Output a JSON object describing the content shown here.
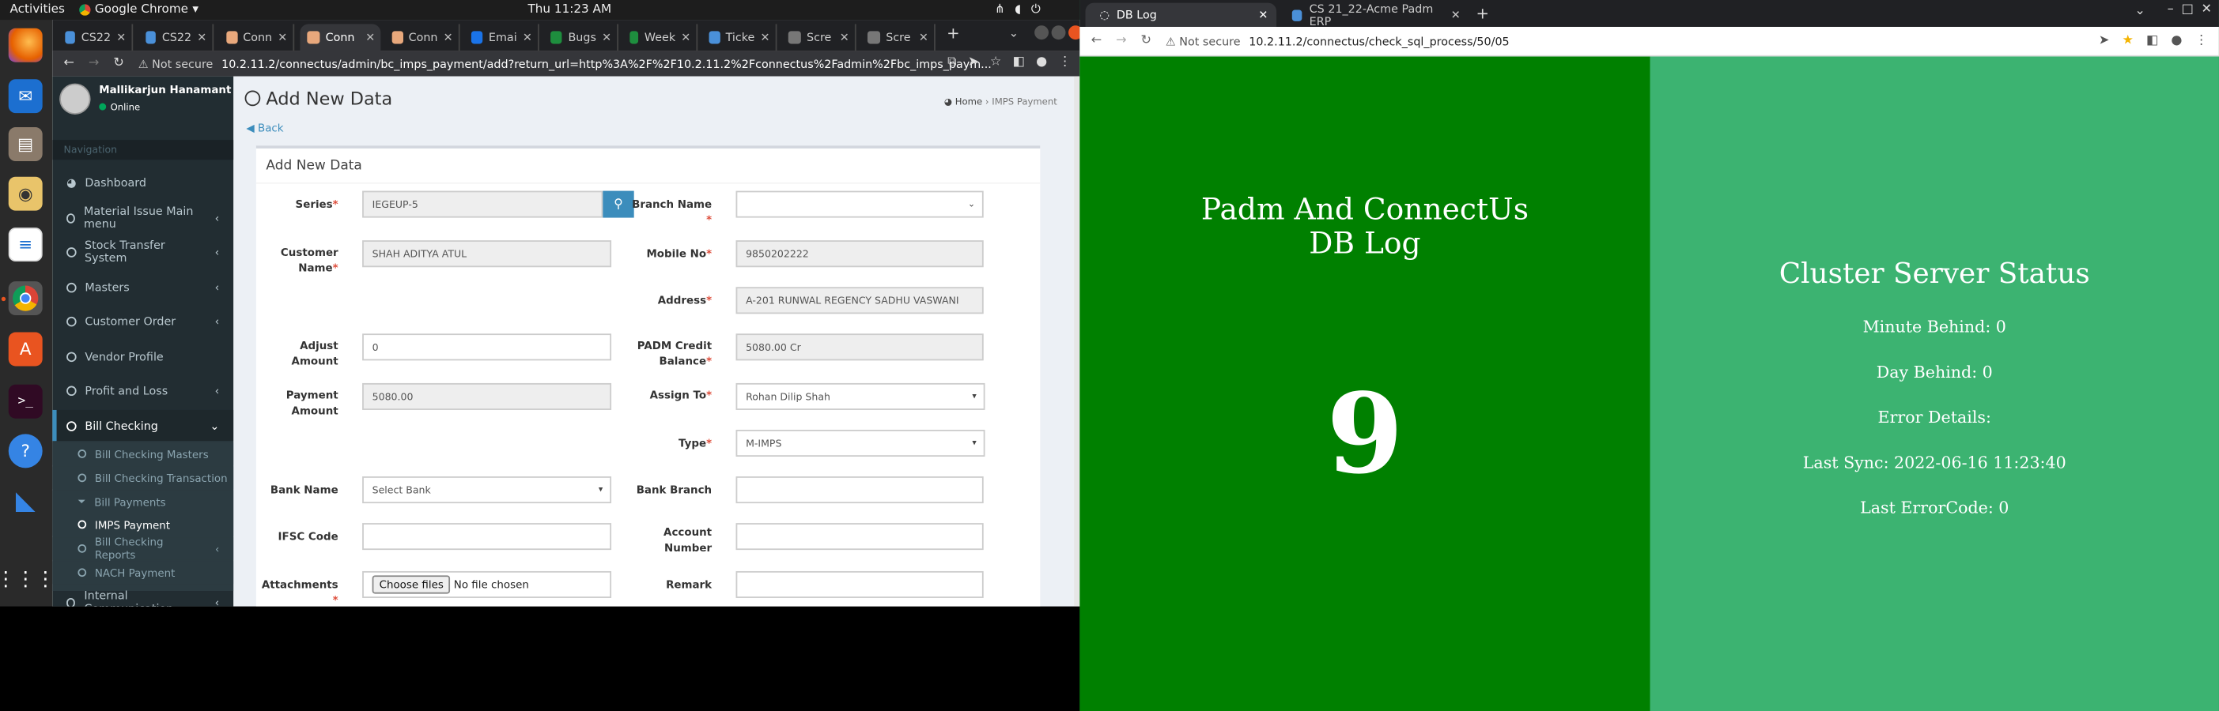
{
  "topbar": {
    "activities": "Activities",
    "app": "Google Chrome",
    "clock": "Thu 11:23 AM"
  },
  "left_browser": {
    "tabs": [
      {
        "label": "CS22",
        "color": "#4a90d9"
      },
      {
        "label": "CS22",
        "color": "#4a90d9"
      },
      {
        "label": "Conn",
        "color": "#e8a87c"
      },
      {
        "label": "Conn",
        "color": "#e8a87c",
        "active": true
      },
      {
        "label": "Conn",
        "color": "#e8a87c"
      },
      {
        "label": "Emai",
        "color": "#1a73e8"
      },
      {
        "label": "Bugs",
        "color": "#1e8e3e"
      },
      {
        "label": "Week",
        "color": "#1e8e3e"
      },
      {
        "label": "Ticke",
        "color": "#4a90d9"
      },
      {
        "label": "Scre",
        "color": "#777"
      },
      {
        "label": "Scre",
        "color": "#777"
      }
    ],
    "not_secure": "Not secure",
    "url": "10.2.11.2/connectus/admin/bc_imps_payment/add?return_url=http%3A%2F%2F10.2.11.2%2Fconnectus%2Fadmin%2Fbc_imps_paym..."
  },
  "sidebar": {
    "user_name": "Mallikarjun Hanamant Kun",
    "status": "Online",
    "nav_header": "Navigation",
    "items": [
      {
        "label": "Dashboard"
      },
      {
        "label": "Material Issue Main menu"
      },
      {
        "label": "Stock Transfer System"
      },
      {
        "label": "Masters"
      },
      {
        "label": "Customer Order"
      },
      {
        "label": "Vendor Profile"
      },
      {
        "label": "Profit and Loss"
      },
      {
        "label": "Bill Checking"
      }
    ],
    "sub_items": [
      {
        "label": "Bill Checking Masters"
      },
      {
        "label": "Bill Checking Transaction"
      },
      {
        "label": "Bill Payments"
      },
      {
        "label": "IMPS Payment"
      },
      {
        "label": "Bill Checking Reports"
      },
      {
        "label": "NACH Payment"
      }
    ],
    "last_item": "Internal Communication"
  },
  "page": {
    "title": "Add New Data",
    "breadcrumb_home": "Home",
    "breadcrumb_current": "IMPS Payment",
    "back": "Back",
    "box_title": "Add New Data"
  },
  "form": {
    "series_label": "Series",
    "series_value": "IEGEUP-5",
    "branch_label": "Branch Name",
    "customer_label_1": "Customer",
    "customer_label_2": "Name",
    "customer_value": "SHAH ADITYA ATUL",
    "mobile_label": "Mobile No",
    "mobile_value": "9850202222",
    "address_label": "Address",
    "address_value": "A-201 RUNWAL REGENCY SADHU VASWANI",
    "adjust_label_1": "Adjust",
    "adjust_label_2": "Amount",
    "adjust_value": "0",
    "credit_label_1": "PADM Credit",
    "credit_label_2": "Balance",
    "credit_value": "5080.00 Cr",
    "payment_label_1": "Payment",
    "payment_label_2": "Amount",
    "payment_value": "5080.00",
    "assign_label": "Assign To",
    "assign_value": "Rohan Dilip Shah",
    "type_label": "Type",
    "type_value": "M-IMPS",
    "bank_label": "Bank Name",
    "bank_value": "Select Bank",
    "branch2_label": "Bank Branch",
    "ifsc_label": "IFSC Code",
    "account_label_1": "Account",
    "account_label_2": "Number",
    "attach_label": "Attachments",
    "file_btn": "Choose files",
    "file_none": "No file chosen",
    "remark_label": "Remark"
  },
  "right_browser": {
    "tab1": "DB Log",
    "tab2": "CS 21_22-Acme Padm ERP",
    "not_secure": "Not secure",
    "url": "10.2.11.2/connectus/check_sql_process/50/05"
  },
  "dblog": {
    "title_1": "Padm And ConnectUs",
    "title_2": "DB Log",
    "count": "9",
    "cluster_title": "Cluster Server Status",
    "minute_behind": "Minute Behind: 0",
    "day_behind": "Day Behind: 0",
    "error_details": "Error Details:",
    "last_sync": "Last Sync: 2022-06-16 11:23:40",
    "last_error": "Last ErrorCode: 0"
  }
}
